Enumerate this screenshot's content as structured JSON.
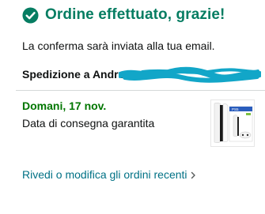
{
  "header": {
    "title": "Ordine effettuato, grazie!",
    "icon": "check-circle-icon",
    "accent_color": "#067d62"
  },
  "confirmation": {
    "text": "La conferma sarà inviata alla tua email."
  },
  "shipping": {
    "label": "Spedizione a Andrea C",
    "redacted_color": "#12a6c8"
  },
  "delivery": {
    "date": "Domani, 17 nov.",
    "date_color": "#007600",
    "note": "Data di consegna garantita"
  },
  "product": {
    "icon": "ps5-console-icon"
  },
  "links": {
    "recent_orders": "Rivedi o modifica gli ordini recenti",
    "link_color": "#007185"
  }
}
